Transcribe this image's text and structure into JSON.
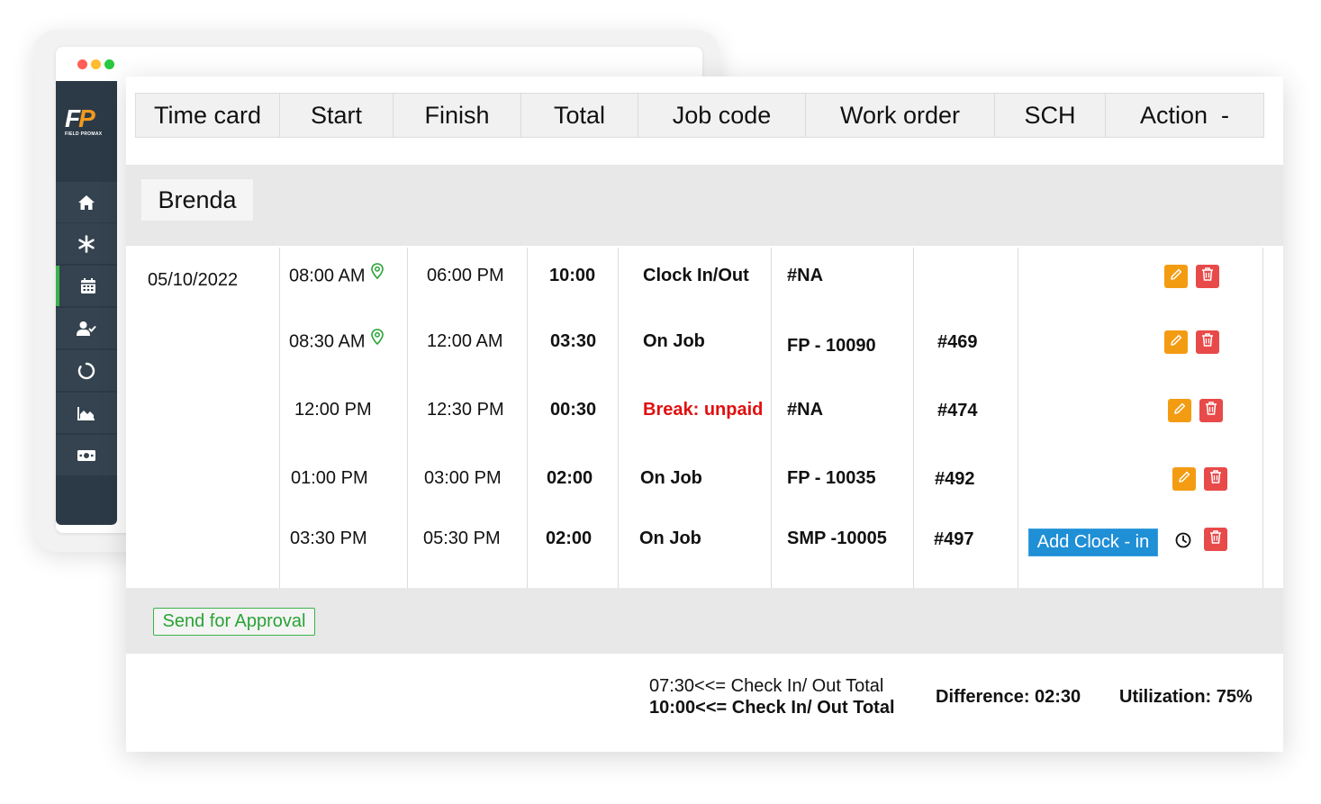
{
  "window": {
    "dot_colors": [
      "#ff5f57",
      "#febc2e",
      "#28c840"
    ]
  },
  "logo": {
    "letter1": "F",
    "letter2": "P",
    "subtitle": "FIELD PROMAX"
  },
  "sidebar": {
    "items": [
      {
        "icon": "home-icon"
      },
      {
        "icon": "asterisk-icon"
      },
      {
        "icon": "calendar-icon",
        "active": true
      },
      {
        "icon": "user-check-icon"
      },
      {
        "icon": "refresh-circle-icon"
      },
      {
        "icon": "area-chart-icon"
      },
      {
        "icon": "money-icon"
      }
    ],
    "accent_color": "#3cb34a"
  },
  "table": {
    "headers": [
      "Time card",
      "Start",
      "Finish",
      "Total",
      "Job code",
      "Work order",
      "SCH",
      "Action  -"
    ]
  },
  "employee": {
    "name": "Brenda"
  },
  "date": "05/10/2022",
  "rows": [
    {
      "start": "08:00 AM",
      "start_pin": true,
      "finish": "06:00 PM",
      "total": "10:00",
      "job_code": "Clock In/Out",
      "job_style": "bold",
      "work_order": "#NA",
      "sch": "",
      "actions": [
        "edit",
        "delete"
      ]
    },
    {
      "start": "08:30 AM",
      "start_pin": true,
      "finish": "12:00 AM",
      "total": "03:30",
      "job_code": "On Job",
      "job_style": "semibold",
      "work_order": "FP - 10090",
      "sch": "#469",
      "actions": [
        "edit",
        "delete"
      ]
    },
    {
      "start": "12:00 PM",
      "start_pin": false,
      "finish": "12:30 PM",
      "total": "00:30",
      "job_code": "Break: unpaid",
      "job_style": "red",
      "work_order": "#NA",
      "sch": "#474",
      "actions": [
        "edit",
        "delete"
      ]
    },
    {
      "start": "01:00 PM",
      "start_pin": false,
      "finish": "03:00 PM",
      "total": "02:00",
      "job_code": "On Job",
      "job_style": "semibold",
      "work_order": "FP - 10035",
      "sch": "#492",
      "actions": [
        "edit",
        "delete"
      ]
    },
    {
      "start": "03:30 PM",
      "start_pin": false,
      "finish": "05:30 PM",
      "total": "02:00",
      "job_code": "On Job",
      "job_style": "semibold",
      "work_order": "SMP -10005",
      "sch": "#497",
      "actions": [
        "add-clock-in",
        "clock",
        "delete"
      ]
    }
  ],
  "add_clock_in_label": "Add Clock - in",
  "approval_button": "Send for Approval",
  "footer": {
    "checkin_total_1": "07:30<<= Check In/ Out Total",
    "checkin_total_2": "10:00<<= Check In/ Out Total",
    "difference": "Difference: 02:30",
    "utilization": "Utilization: 75%"
  },
  "colors": {
    "edit_button": "#f39c12",
    "delete_button": "#e84a4a",
    "add_clock_button": "#1f8fd6",
    "approval_green": "#2aa336",
    "pin_green": "#2aa336",
    "break_red": "#e01010",
    "sidebar_bg": "#2c3a47"
  }
}
